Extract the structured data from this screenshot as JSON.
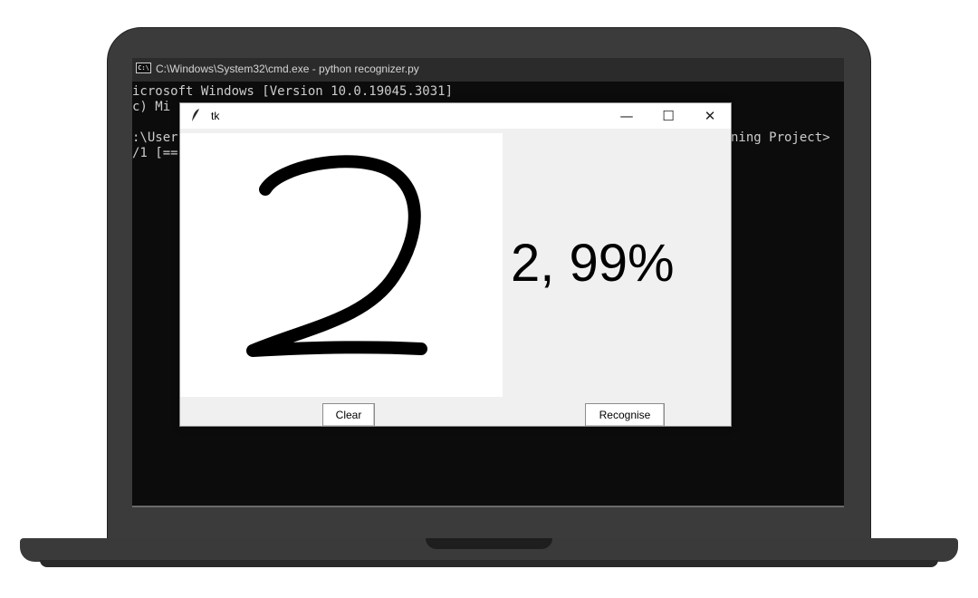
{
  "cmd": {
    "icon_text": "C:\\",
    "title": "C:\\Windows\\System32\\cmd.exe - python  recognizer.py",
    "lines": [
      "icrosoft Windows [Version 10.0.19045.3031]",
      "c) Mi",
      ":\\User",
      "/1 [=="
    ],
    "right_fragment": "ning Project>"
  },
  "tk": {
    "title": "tk",
    "icon": "feather-icon",
    "minimize": "—",
    "maximize": "☐",
    "close": "✕",
    "drawn_digit": "2",
    "result": "2, 99%",
    "clear_label": "Clear",
    "recognise_label": "Recognise"
  }
}
